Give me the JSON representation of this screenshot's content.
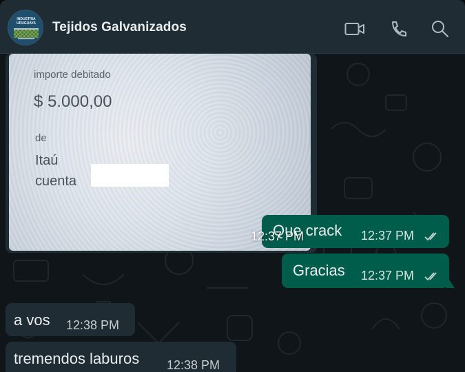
{
  "header": {
    "contact_name": "Tejidos Galvanizados",
    "avatar_text": "INDUSTRIA URUGUAYA",
    "icons": [
      "video-call-icon",
      "phone-icon",
      "search-icon"
    ]
  },
  "image_message": {
    "lines": {
      "label1": "importe debitado",
      "amount": "$ 5.000,00",
      "label2": "de",
      "bank": "Itaú",
      "account": "cuenta"
    },
    "time": "12:37 PM"
  },
  "messages": [
    {
      "direction": "out",
      "text": "Que crack",
      "time": "12:37 PM",
      "status": "read-ticks"
    },
    {
      "direction": "out",
      "text": "Gracias",
      "time": "12:37 PM",
      "status": "read-ticks"
    },
    {
      "direction": "in",
      "text": "a vos",
      "time": "12:38 PM"
    },
    {
      "direction": "in",
      "text": "tremendos laburos",
      "time": "12:38 PM"
    }
  ],
  "colors": {
    "header_bg": "#202c33",
    "outgoing_bubble": "#005c4b",
    "incoming_bubble": "#202c33",
    "chat_bg": "#0f1519"
  }
}
